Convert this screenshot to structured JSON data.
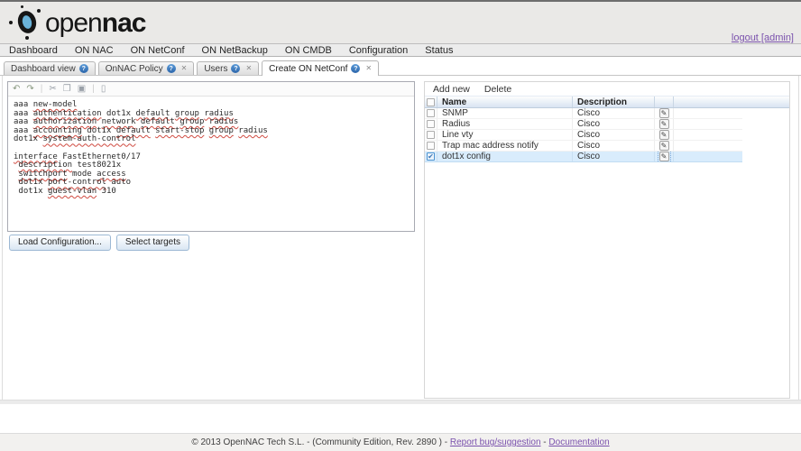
{
  "header": {
    "logo": {
      "part1": "open",
      "part2": "nac"
    },
    "logout_link": "logout [admin]"
  },
  "menu": {
    "items": [
      "Dashboard",
      "ON NAC",
      "ON NetConf",
      "ON NetBackup",
      "ON CMDB",
      "Configuration",
      "Status"
    ]
  },
  "tabs": [
    {
      "label": "Dashboard view",
      "closable": false,
      "active": false
    },
    {
      "label": "OnNAC Policy",
      "closable": true,
      "active": false
    },
    {
      "label": "Users",
      "closable": true,
      "active": false
    },
    {
      "label": "Create ON NetConf",
      "closable": true,
      "active": true
    }
  ],
  "icons": {
    "tab_help_glyph": "?",
    "tab_close_glyph": "✕",
    "edit_glyph": "✎",
    "check_glyph": "✔"
  },
  "editor": {
    "toolbar_icons": [
      {
        "name": "undo-icon",
        "glyph": "↶",
        "style": "green"
      },
      {
        "name": "redo-icon",
        "glyph": "↷",
        "style": "green"
      },
      {
        "sep": true
      },
      {
        "name": "cut-icon",
        "glyph": "✂",
        "style": "gray"
      },
      {
        "name": "copy-icon",
        "glyph": "❐",
        "style": "gray"
      },
      {
        "name": "paste-icon",
        "glyph": "▣",
        "style": "gray"
      },
      {
        "sep": true
      },
      {
        "name": "new-document-icon",
        "glyph": "▯",
        "style": "gray"
      }
    ],
    "lines": [
      [
        {
          "t": "aaa ",
          "u": false
        },
        {
          "t": "new-model",
          "u": true
        }
      ],
      [
        {
          "t": "aaa ",
          "u": false
        },
        {
          "t": "authentication",
          "u": true
        },
        {
          "t": " dot1x ",
          "u": false
        },
        {
          "t": "default",
          "u": true
        },
        {
          "t": " ",
          "u": false
        },
        {
          "t": "group",
          "u": true
        },
        {
          "t": " ",
          "u": false
        },
        {
          "t": "radius",
          "u": true
        }
      ],
      [
        {
          "t": "aaa ",
          "u": false
        },
        {
          "t": "authorization",
          "u": true
        },
        {
          "t": " ",
          "u": false
        },
        {
          "t": "network",
          "u": true
        },
        {
          "t": " ",
          "u": false
        },
        {
          "t": "default",
          "u": true
        },
        {
          "t": " ",
          "u": false
        },
        {
          "t": "group",
          "u": true
        },
        {
          "t": " ",
          "u": false
        },
        {
          "t": "radius",
          "u": true
        }
      ],
      [
        {
          "t": "aaa ",
          "u": false
        },
        {
          "t": "accounting",
          "u": true
        },
        {
          "t": " dot1x ",
          "u": false
        },
        {
          "t": "default",
          "u": true
        },
        {
          "t": " ",
          "u": false
        },
        {
          "t": "start-stop",
          "u": true
        },
        {
          "t": " ",
          "u": false
        },
        {
          "t": "group",
          "u": true
        },
        {
          "t": " ",
          "u": false
        },
        {
          "t": "radius",
          "u": true
        }
      ],
      [
        {
          "t": "dot1x ",
          "u": false
        },
        {
          "t": "system-auth-control",
          "u": true
        }
      ],
      [],
      [
        {
          "t": "interface",
          "u": true
        },
        {
          "t": " FastEthernet0/17",
          "u": false
        }
      ],
      [
        {
          "t": " ",
          "u": false
        },
        {
          "t": "description",
          "u": true
        },
        {
          "t": " test8021x",
          "u": false
        }
      ],
      [
        {
          "t": " ",
          "u": false
        },
        {
          "t": "switchport",
          "u": true
        },
        {
          "t": " mode ",
          "u": false
        },
        {
          "t": "access",
          "u": true
        }
      ],
      [
        {
          "t": " dot1x ",
          "u": false
        },
        {
          "t": "port-control",
          "u": true
        },
        {
          "t": " auto",
          "u": false
        }
      ],
      [
        {
          "t": " dot1x ",
          "u": false
        },
        {
          "t": "guest-vlan",
          "u": true
        },
        {
          "t": " 310",
          "u": false
        }
      ]
    ],
    "buttons": {
      "load": "Load Configuration...",
      "select": "Select targets"
    }
  },
  "grid": {
    "toolbar": [
      "Add new",
      "Delete"
    ],
    "columns": [
      "Name",
      "Description"
    ],
    "rows": [
      {
        "name": "SNMP",
        "description": "Cisco",
        "checked": false,
        "selected": false
      },
      {
        "name": "Radius",
        "description": "Cisco",
        "checked": false,
        "selected": false
      },
      {
        "name": "Line vty",
        "description": "Cisco",
        "checked": false,
        "selected": false
      },
      {
        "name": "Trap mac address notify",
        "description": "Cisco",
        "checked": false,
        "selected": false
      },
      {
        "name": "dot1x config",
        "description": "Cisco",
        "checked": true,
        "selected": true
      }
    ]
  },
  "footer": {
    "copyright": "© 2013 OpenNAC Tech S.L. - (Community Edition, Rev. 2890 ) - ",
    "bug_link": "Report bug/suggestion",
    "separator": " - ",
    "docs_link": "Documentation"
  },
  "colors": {
    "brand_blue": "#6ab2d8",
    "link_purple": "#7a51ad",
    "selection_blue": "#d9ecfc",
    "spellcheck_red": "#d04b41",
    "grid_header_blue": "#d8e4f2"
  }
}
